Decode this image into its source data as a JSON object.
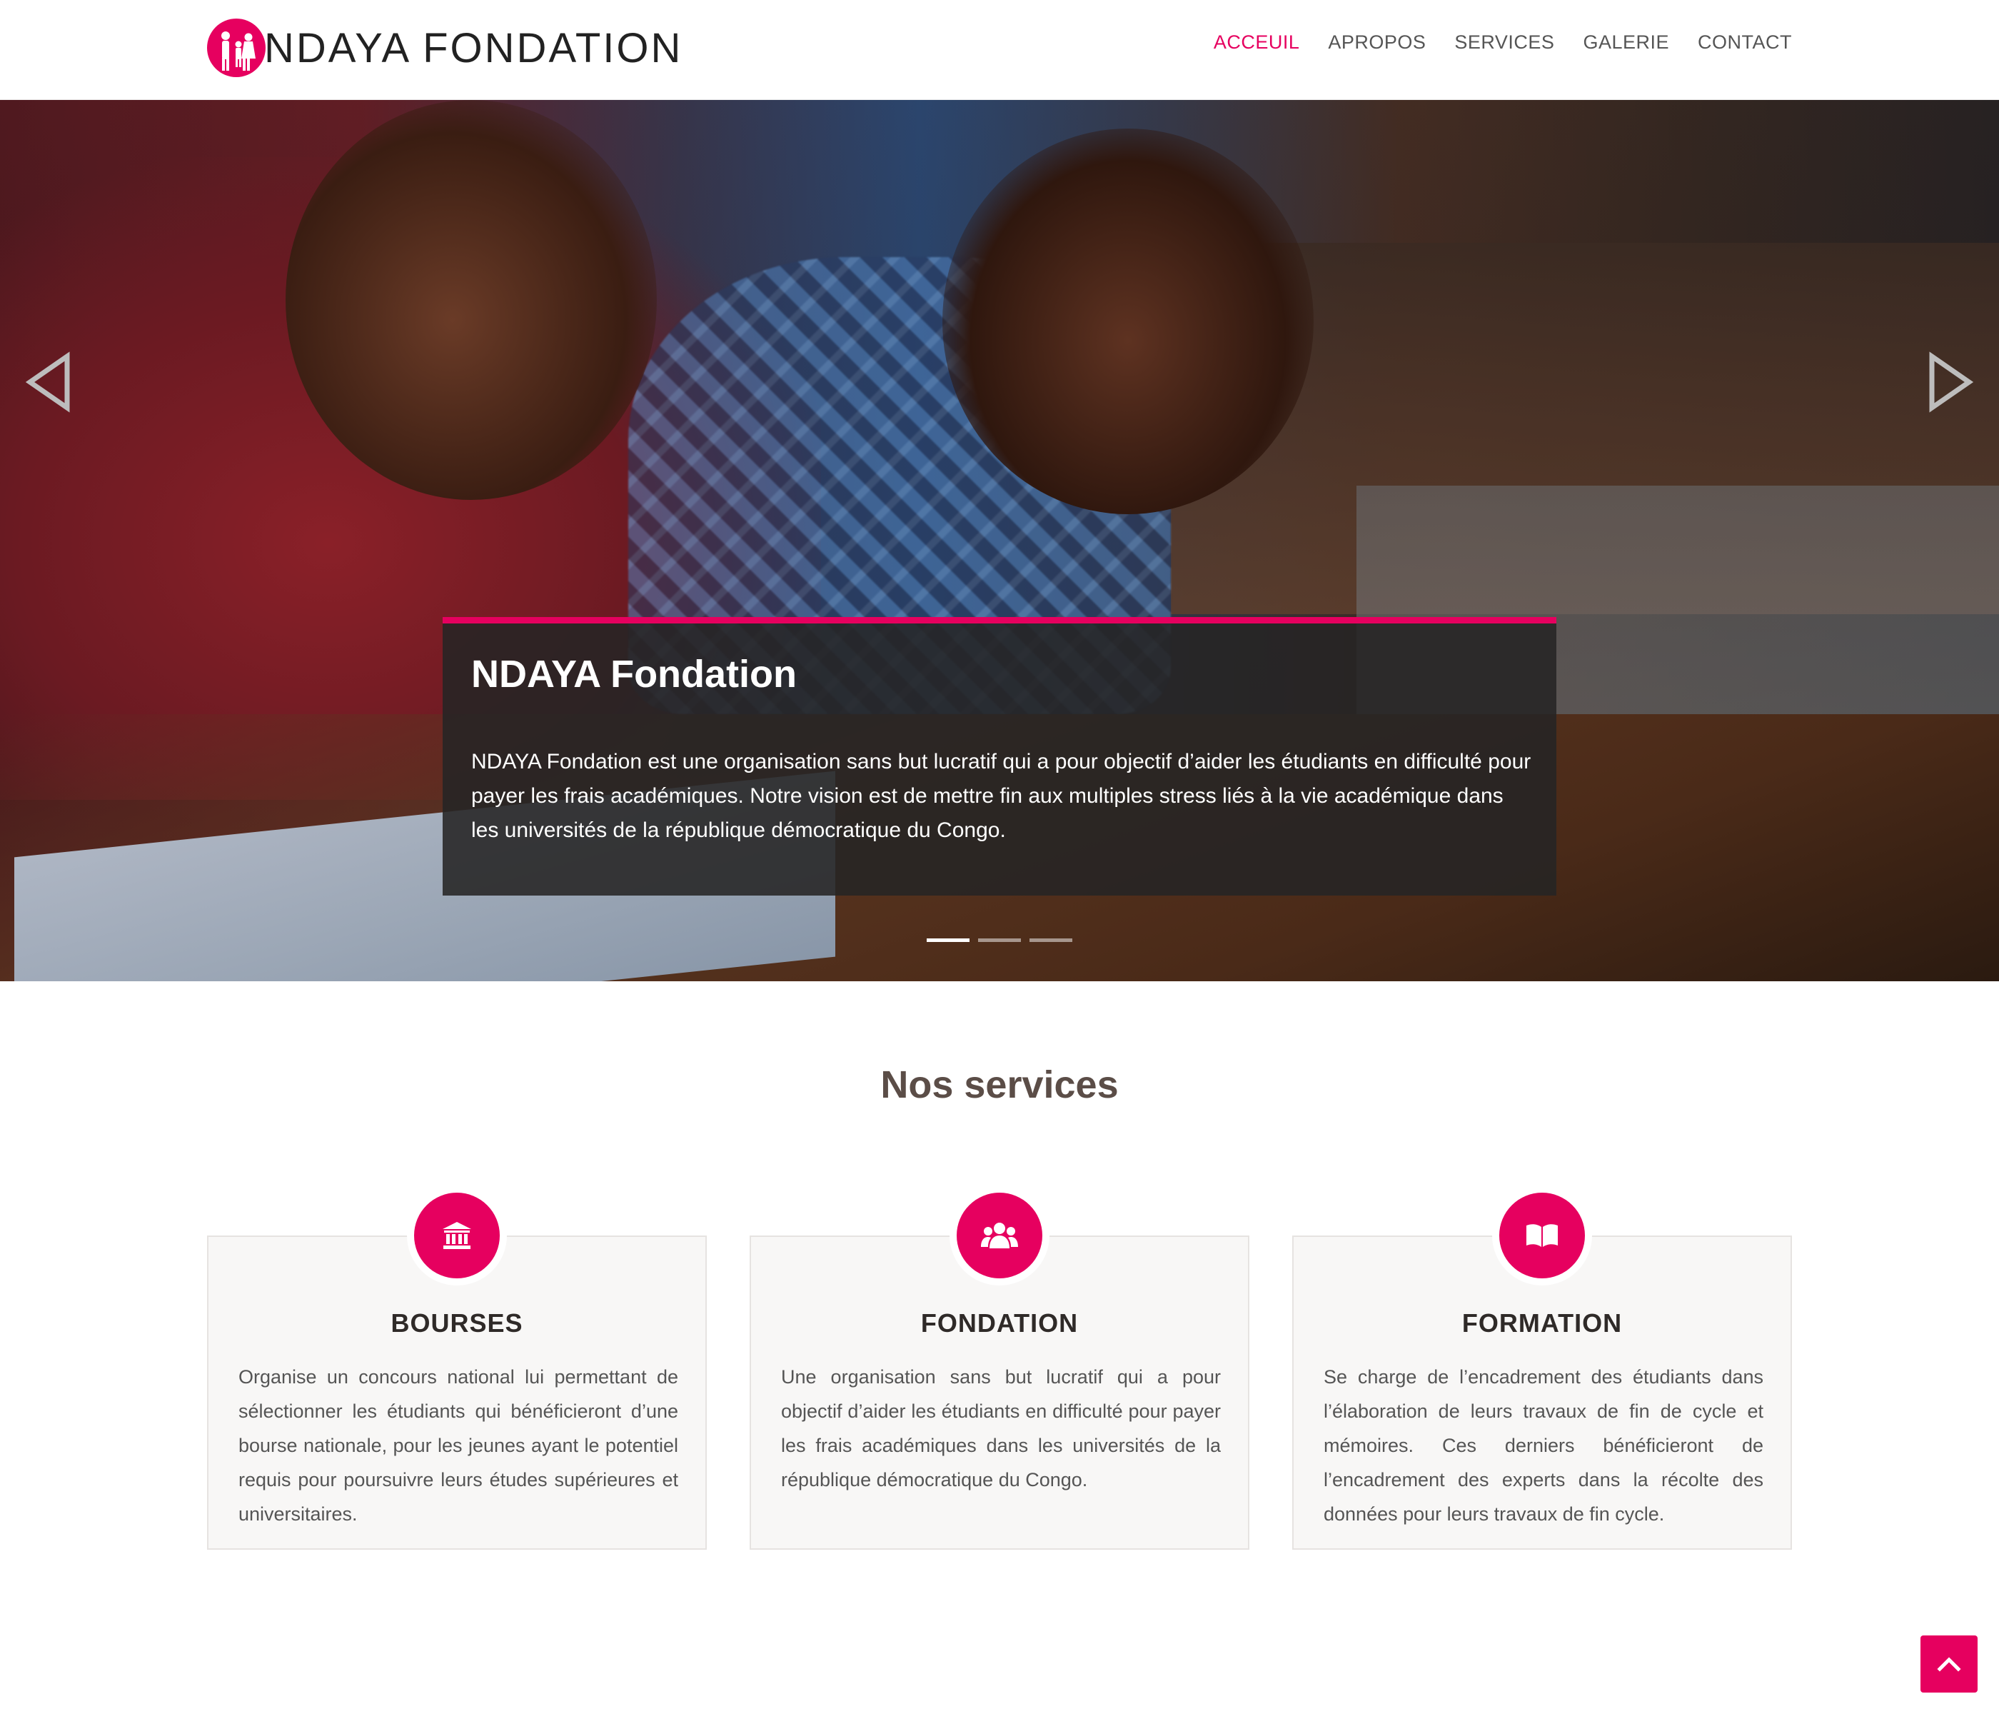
{
  "brand": {
    "name": "NDAYA FONDATION",
    "accent_color": "#e6005f",
    "logo_icon": "family-silhouette-icon"
  },
  "nav": {
    "items": [
      {
        "label": "ACCEUIL",
        "active": true
      },
      {
        "label": "APROPOS",
        "active": false
      },
      {
        "label": "SERVICES",
        "active": false
      },
      {
        "label": "GALERIE",
        "active": false
      },
      {
        "label": "CONTACT",
        "active": false
      }
    ]
  },
  "hero": {
    "caption_title": "NDAYA Fondation",
    "caption_text": "NDAYA Fondation est une organisation sans but lucratif qui a pour objectif d’aider les étudiants en difficulté pour payer les frais académiques. Notre vision est de mettre fin aux multiples stress liés à la vie académique dans les universités de la république démocratique du Congo.",
    "slides_count": 3,
    "active_slide": 1
  },
  "services": {
    "title": "Nos services",
    "cards": [
      {
        "icon": "university-icon",
        "title": "BOURSES",
        "text": "Organise un concours national lui permettant de sélectionner les étudiants qui bénéficieront d’une bourse nationale, pour les jeunes ayant le potentiel requis pour poursuivre leurs études supérieures et universitaires."
      },
      {
        "icon": "users-icon",
        "title": "FONDATION",
        "text": "Une organisation sans but lucratif qui a pour objectif d’aider les étudiants en difficulté pour payer les frais académiques dans les universités de la république démocratique du Congo."
      },
      {
        "icon": "open-book-icon",
        "title": "FORMATION",
        "text": "Se charge de l’encadrement des étudiants dans l’élaboration de leurs travaux de fin de cycle et mémoires. Ces derniers bénéficieront de l’encadrement des experts dans la récolte des données pour leurs travaux de fin cycle."
      }
    ]
  },
  "back_to_top": {
    "icon": "chevron-up-icon"
  }
}
